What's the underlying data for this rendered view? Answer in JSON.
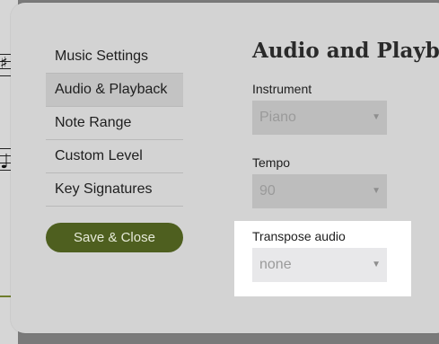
{
  "sidebar": {
    "items": [
      {
        "label": "Music Settings",
        "active": false
      },
      {
        "label": "Audio & Playback",
        "active": true
      },
      {
        "label": "Note Range",
        "active": false
      },
      {
        "label": "Custom Level",
        "active": false
      },
      {
        "label": "Key Signatures",
        "active": false
      }
    ]
  },
  "actions": {
    "save_label": "Save & Close"
  },
  "panel": {
    "title": "Audio and Playback",
    "instrument": {
      "label": "Instrument",
      "value": "Piano"
    },
    "tempo": {
      "label": "Tempo",
      "value": "90"
    },
    "transpose": {
      "label": "Transpose audio",
      "value": "none",
      "highlighted": true
    }
  },
  "icons": {
    "caret": "chevron-down-icon"
  },
  "colors": {
    "accent": "#4e5f1f",
    "modal_bg": "#d3d3d3",
    "highlight": "#ffffff"
  }
}
